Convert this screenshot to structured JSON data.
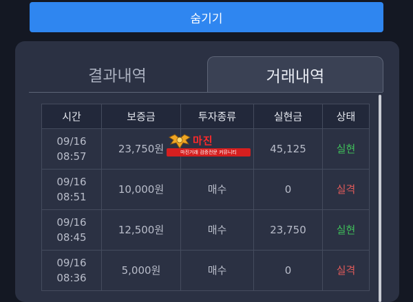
{
  "hide_button": {
    "label": "숨기기"
  },
  "tabs": [
    {
      "label": "결과내역",
      "active": false
    },
    {
      "label": "거래내역",
      "active": true
    }
  ],
  "table": {
    "headers": [
      "시간",
      "보증금",
      "투자종류",
      "실현금",
      "상태"
    ],
    "rows": [
      {
        "date": "09/16",
        "time": "08:57",
        "deposit": "23,750원",
        "type": "",
        "realized": "45,125",
        "status": "실현",
        "status_kind": "success"
      },
      {
        "date": "09/16",
        "time": "08:51",
        "deposit": "10,000원",
        "type": "매수",
        "realized": "0",
        "status": "실격",
        "status_kind": "fail"
      },
      {
        "date": "09/16",
        "time": "08:45",
        "deposit": "12,500원",
        "type": "매수",
        "realized": "23,750",
        "status": "실현",
        "status_kind": "success"
      },
      {
        "date": "09/16",
        "time": "08:36",
        "deposit": "5,000원",
        "type": "매수",
        "realized": "0",
        "status": "실격",
        "status_kind": "fail"
      }
    ]
  },
  "watermark": {
    "title": "마진",
    "subtitle": "마진거래 검증전문 커뮤니티"
  },
  "colors": {
    "accent": "#2f86f0",
    "success": "#3fbf5a",
    "fail": "#e05a5a",
    "panel": "#2b3143",
    "background": "#141823"
  }
}
